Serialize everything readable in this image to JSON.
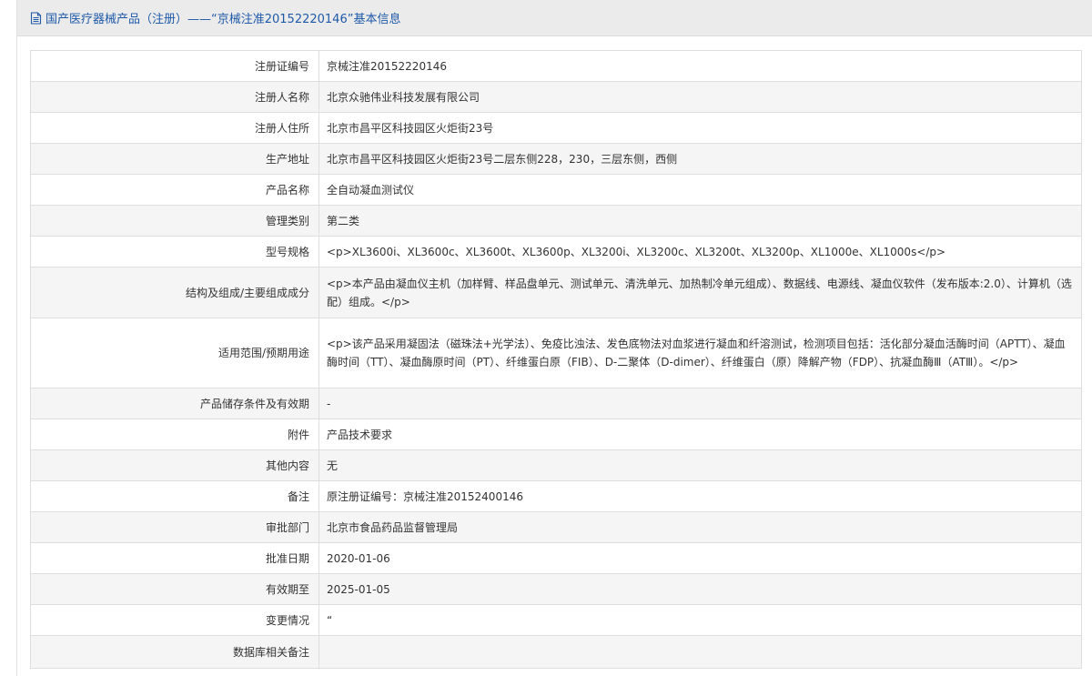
{
  "header": {
    "title": "国产医疗器械产品（注册）——“京械注准20152220146”基本信息"
  },
  "rows": [
    {
      "label": "注册证编号",
      "value": "京械注准20152220146"
    },
    {
      "label": "注册人名称",
      "value": "北京众驰伟业科技发展有限公司"
    },
    {
      "label": "注册人住所",
      "value": "北京市昌平区科技园区火炬街23号"
    },
    {
      "label": "生产地址",
      "value": "北京市昌平区科技园区火炬街23号二层东侧228，230，三层东侧，西侧"
    },
    {
      "label": "产品名称",
      "value": "全自动凝血测试仪"
    },
    {
      "label": "管理类别",
      "value": "第二类"
    },
    {
      "label": "型号规格",
      "value": "<p>XL3600i、XL3600c、XL3600t、XL3600p、XL3200i、XL3200c、XL3200t、XL3200p、XL1000e、XL1000s</p>"
    },
    {
      "label": "结构及组成/主要组成成分",
      "value": "<p>本产品由凝血仪主机（加样臂、样品盘单元、测试单元、清洗单元、加热制冷单元组成）、数据线、电源线、凝血仪软件（发布版本:2.0）、计算机（选配）组成。</p>"
    },
    {
      "label": "适用范围/预期用途",
      "value": "<p>该产品采用凝固法（磁珠法+光学法）、免疫比浊法、发色底物法对血浆进行凝血和纤溶测试，检测项目包括：活化部分凝血活酶时间（APTT）、凝血酶时间（TT）、凝血酶原时间（PT）、纤维蛋白原（FIB）、D-二聚体（D-dimer）、纤维蛋白（原）降解产物（FDP）、抗凝血酶Ⅲ（ATⅢ）。</p>"
    },
    {
      "label": "产品储存条件及有效期",
      "value": "-"
    },
    {
      "label": "附件",
      "value": "产品技术要求"
    },
    {
      "label": "其他内容",
      "value": "无"
    },
    {
      "label": "备注",
      "value": "原注册证编号：京械注准20152400146"
    },
    {
      "label": "审批部门",
      "value": "北京市食品药品监督管理局"
    },
    {
      "label": "批准日期",
      "value": "2020-01-06"
    },
    {
      "label": "有效期至",
      "value": "2025-01-05"
    },
    {
      "label": "变更情况",
      "value": "“"
    },
    {
      "label": "数据库相关备注",
      "value": ""
    }
  ]
}
